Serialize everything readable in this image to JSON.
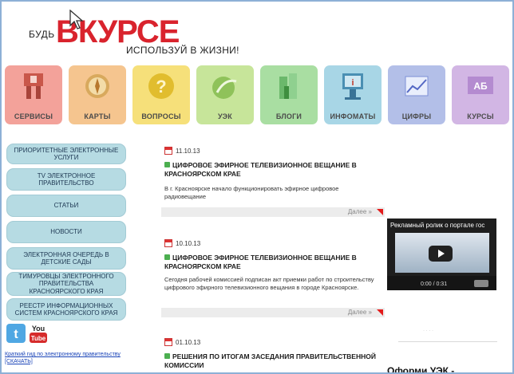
{
  "header": {
    "logo_pre": "БУДЬ",
    "logo_brand_1": "В",
    "logo_brand_2": "КУРСЕ",
    "slogan": "ИСПОЛЬЗУЙ В ЖИЗНИ!"
  },
  "tiles": [
    {
      "label": "СЕРВИСЫ",
      "color": "#f3a29a"
    },
    {
      "label": "КАРТЫ",
      "color": "#f5c58f"
    },
    {
      "label": "ВОПРОСЫ",
      "color": "#f6e07a"
    },
    {
      "label": "УЭК",
      "color": "#c7e59a"
    },
    {
      "label": "БЛОГИ",
      "color": "#a9dea2"
    },
    {
      "label": "ИНФОМАТЫ",
      "color": "#a8d6e6"
    },
    {
      "label": "ЦИФРЫ",
      "color": "#b3bfe8"
    },
    {
      "label": "КУРСЫ",
      "color": "#d2b6e4"
    }
  ],
  "menu": [
    "ПРИОРИТЕТНЫЕ ЭЛЕКТРОННЫЕ УСЛУГИ",
    "TV ЭЛЕКТРОННОЕ ПРАВИТЕЛЬСТВО",
    "СТАТЬИ",
    "НОВОСТИ",
    "ЭЛЕКТРОННАЯ ОЧЕРЕДЬ В ДЕТСКИЕ САДЫ",
    "ТИМУРОВЦЫ ЭЛЕКТРОННОГО ПРАВИТЕЛЬСТВА КРАСНОЯРСКОГО КРАЯ",
    "РЕЕСТР ИНФОРМАЦИОННЫХ СИСТЕМ КРАСНОЯРСКОГО КРАЯ"
  ],
  "social": {
    "twitter_icon": "twitter-icon",
    "youtube_label": "You Tube"
  },
  "guide_link": "Краткий гид по электронному правительству [СКАЧАТЬ]",
  "news": [
    {
      "date": "11.10.13",
      "title": "ЦИФРОВОЕ ЭФИРНОЕ ТЕЛЕВИЗИОННОЕ ВЕЩАНИЕ В КРАСНОЯРСКОМ КРАЕ",
      "body": "В г. Красноярске начало функционировать эфирное цифровое радиовещание",
      "more": "Далее »"
    },
    {
      "date": "10.10.13",
      "title": "ЦИФРОВОЕ ЭФИРНОЕ ТЕЛЕВИЗИОННОЕ ВЕЩАНИЕ В КРАСНОЯРСКОМ КРАЕ",
      "body": "Сегодня рабочей комиссией подписан акт приемки работ по строительству цифрового эфирного телевизионного вещания в городе Красноярске.",
      "more": "Далее »"
    },
    {
      "date": "01.10.13",
      "title": "РЕШЕНИЯ ПО ИТОГАМ ЗАСЕДАНИЯ ПРАВИТЕЛЬСТВЕННОЙ КОМИССИИ"
    }
  ],
  "video": {
    "title": "Рекламный ролик о портале гос",
    "time": "0:00 / 0:31"
  },
  "right_heading": "Оформи УЭК -"
}
